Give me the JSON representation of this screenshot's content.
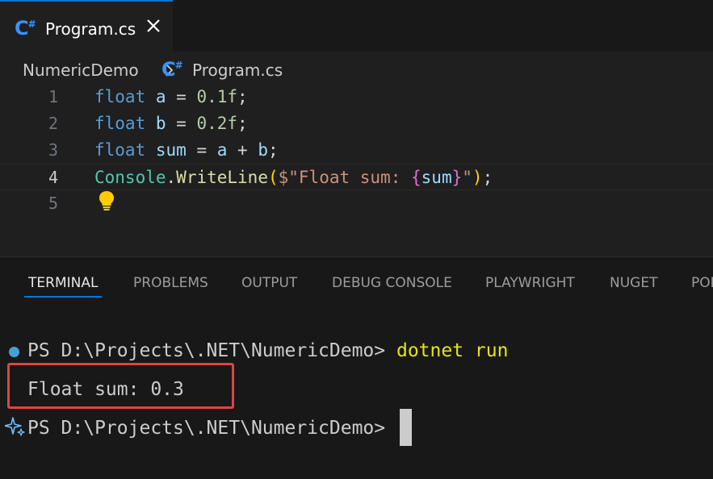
{
  "tab": {
    "icon": "csharp-file-icon",
    "label": "Program.cs",
    "close_icon": "close-icon"
  },
  "breadcrumb": {
    "folder": "NumericDemo",
    "separator_icon": "chevron-right-icon",
    "file_icon": "csharp-file-icon",
    "file": "Program.cs"
  },
  "editor": {
    "current_line": 4,
    "lines": [
      {
        "number": "1",
        "tokens": [
          [
            "kw",
            "float"
          ],
          [
            "plain",
            " "
          ],
          [
            "var",
            "a"
          ],
          [
            "plain",
            " = "
          ],
          [
            "num",
            "0.1f"
          ],
          [
            "plain",
            ";"
          ]
        ]
      },
      {
        "number": "2",
        "tokens": [
          [
            "kw",
            "float"
          ],
          [
            "plain",
            " "
          ],
          [
            "var",
            "b"
          ],
          [
            "plain",
            " = "
          ],
          [
            "num",
            "0.2f"
          ],
          [
            "plain",
            ";"
          ]
        ]
      },
      {
        "number": "3",
        "tokens": [
          [
            "kw",
            "float"
          ],
          [
            "plain",
            " "
          ],
          [
            "var",
            "sum"
          ],
          [
            "plain",
            " = "
          ],
          [
            "var",
            "a"
          ],
          [
            "plain",
            " + "
          ],
          [
            "var",
            "b"
          ],
          [
            "plain",
            ";"
          ]
        ]
      },
      {
        "number": "4",
        "tokens": [
          [
            "cls",
            "Console"
          ],
          [
            "plain",
            "."
          ],
          [
            "fn",
            "WriteLine"
          ],
          [
            "paren",
            "("
          ],
          [
            "str",
            "$\"Float sum: "
          ],
          [
            "brace",
            "{"
          ],
          [
            "var",
            "sum"
          ],
          [
            "brace",
            "}"
          ],
          [
            "str",
            "\""
          ],
          [
            "paren",
            ")"
          ],
          [
            "plain",
            ";"
          ]
        ]
      },
      {
        "number": "5",
        "tokens": []
      }
    ],
    "lightbulb_icon": "lightbulb-icon"
  },
  "panel": {
    "tabs": [
      "TERMINAL",
      "PROBLEMS",
      "OUTPUT",
      "DEBUG CONSOLE",
      "PLAYWRIGHT",
      "NUGET",
      "PORTS"
    ],
    "active_tab": "TERMINAL"
  },
  "terminal": {
    "prompt1": "PS D:\\Projects\\.NET\\NumericDemo> ",
    "command": "dotnet run",
    "output": "Float sum: 0.3",
    "prompt2": "PS D:\\Projects\\.NET\\NumericDemo> ",
    "status_dot_icon": "command-success-dot-icon",
    "sparkle_icon": "sparkle-icon"
  },
  "colors": {
    "accent": "#0078d4",
    "highlight_box": "#e0443f",
    "command": "#e5e510"
  }
}
